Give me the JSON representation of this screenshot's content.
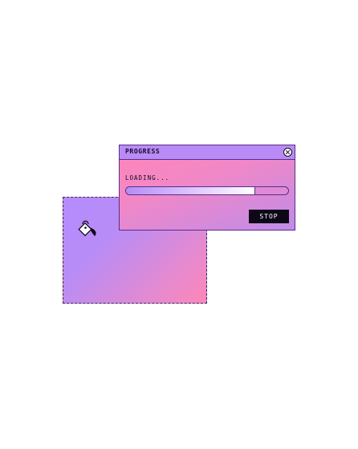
{
  "canvas": {
    "icon": "paint-bucket-icon"
  },
  "dialog": {
    "title": "PROGRESS",
    "close_icon": "close-icon",
    "status_text": "LOADING...",
    "progress": 0.79,
    "stop_label": "STOP"
  },
  "colors": {
    "gradient_purple": "#b58cff",
    "gradient_pink": "#ff86b8",
    "titlebar": "#b98bf7",
    "border": "#5a2c8a",
    "button_bg": "#0d0717",
    "button_text": "#ffffff"
  }
}
